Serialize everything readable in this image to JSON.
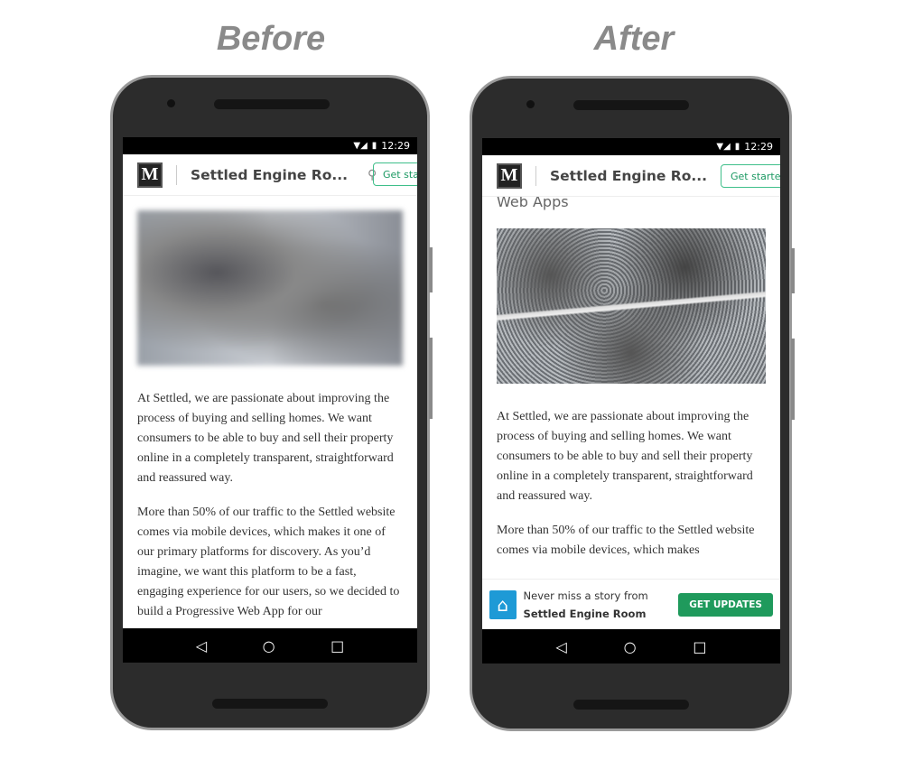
{
  "labels": {
    "before": "Before",
    "after": "After"
  },
  "status": {
    "time": "12:29",
    "wifi_icon": "wifi-icon",
    "signal_icon": "signal-icon",
    "battery_icon": "battery-icon"
  },
  "header": {
    "logo": "M",
    "publication": "Settled Engine Ro...",
    "get_started_left": "Get sta",
    "get_started_right": "Get started",
    "search_icon": "search-icon"
  },
  "after_subtitle": "Web Apps",
  "paragraphs_before": [
    "At Settled, we are passionate about improving the process of buying and selling homes. We want consumers to be able to buy and sell their property online in a completely transparent, straightforward and reassured way.",
    "More than 50% of our traffic to the Settled website comes via mobile devices, which makes it one of our primary platforms for discovery. As you’d imagine, we want this platform to be a fast, engaging experience for our users, so we decided to build a Progressive Web App for our"
  ],
  "paragraphs_after": [
    "At Settled, we are passionate about improving the process of buying and selling homes. We want consumers to be able to buy and sell their property online in a completely transparent, straightforward and reassured way.",
    "More than 50% of our traffic to the Settled website comes via mobile devices, which makes"
  ],
  "banner": {
    "text": "Never miss a story from ",
    "bold": "Settled Engine Room",
    "button": "GET UPDATES",
    "icon": "home-icon",
    "color": "#1f9a5c"
  },
  "nav": {
    "back": "◁",
    "home": "○",
    "recents": "□"
  }
}
